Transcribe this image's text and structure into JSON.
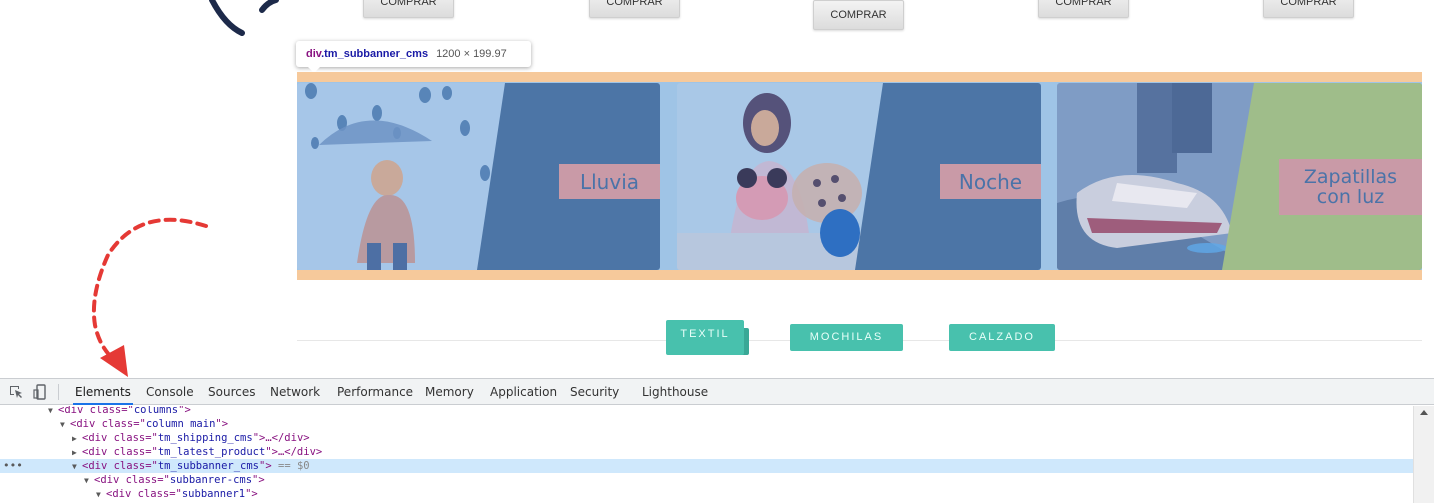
{
  "buy_buttons": [
    {
      "label": "COMPRAR"
    },
    {
      "label": "COMPRAR"
    },
    {
      "label": "COMPRAR"
    },
    {
      "label": "COMPRAR"
    },
    {
      "label": "COMPRAR"
    }
  ],
  "tooltip": {
    "tag": "div",
    "class_name": ".tm_subbanner_cms",
    "dimensions": "1200 × 199.97"
  },
  "banners": [
    {
      "label": "Lluvia"
    },
    {
      "label": "Noche"
    },
    {
      "label_line1": "Zapatillas",
      "label_line2": "con luz"
    }
  ],
  "category_tabs": [
    {
      "label": "TEXTIL"
    },
    {
      "label": "MOCHILAS"
    },
    {
      "label": "CALZADO"
    }
  ],
  "devtools": {
    "tabs": [
      "Elements",
      "Console",
      "Sources",
      "Network",
      "Performance",
      "Memory",
      "Application",
      "Security",
      "Lighthouse"
    ],
    "active_tab": "Elements",
    "dom_rows": [
      {
        "open": "<div class=\"",
        "value": "columns",
        "close": "\">"
      },
      {
        "open": "<div class=\"",
        "value": "column main",
        "close": "\">"
      },
      {
        "open": "<div class=\"",
        "value": "tm_shipping_cms",
        "close": "\">…</div>"
      },
      {
        "open": "<div class=\"",
        "value": "tm_latest_product",
        "close": "\">…</div>"
      },
      {
        "open": "<div class=\"",
        "value": "tm_subbanner_cms",
        "close": "\">",
        "suffix": "== $0"
      },
      {
        "open": "<div class=\"",
        "value": "subbanrer-cms",
        "close": "\">"
      },
      {
        "open": "<div class=\"",
        "value": "subbanner1",
        "close": "\">"
      }
    ]
  },
  "colors": {
    "banner_border": "#f6c99b",
    "overlay_blue": "#9fc4e6",
    "stripe_dark_blue": "#4c75a6",
    "stripe_green": "#9fbd8a",
    "label_pink": "#c99aa7",
    "tab_teal": "#48c1ad",
    "devtools_selected_row": "#cfe8fc",
    "annotation_red": "#e53935"
  }
}
